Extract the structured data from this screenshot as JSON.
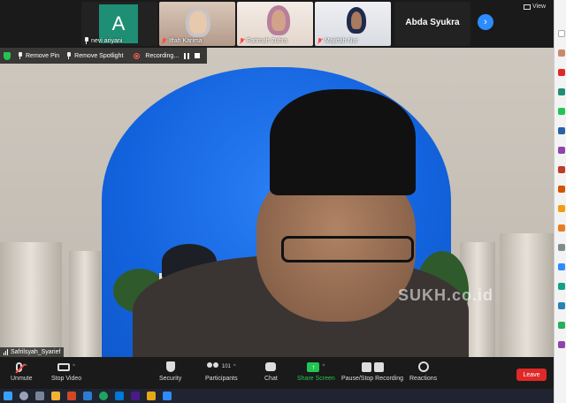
{
  "gallery": {
    "tiles": [
      {
        "name": "nevi ariyani",
        "initial": "A",
        "type": "avatar"
      },
      {
        "name": "Iffah Karima",
        "type": "video"
      },
      {
        "name": "Farimah Zuhra",
        "type": "video"
      },
      {
        "name": "Majidah Nur",
        "type": "video"
      },
      {
        "name": "Abda Syukra",
        "type": "name-only"
      }
    ],
    "next_icon": "chevron-right-icon",
    "view_label": "View"
  },
  "video_controls": {
    "remove_pin": "Remove Pin",
    "remove_spotlight": "Remove Spotlight",
    "recording": "Recording..."
  },
  "speaker": {
    "name": "Safrilsyah_Syarief",
    "watermark": "SUKH.co.id"
  },
  "toolbar": {
    "unmute": "Unmute",
    "stop_video": "Stop Video",
    "security": "Security",
    "participants": "Participants",
    "participant_count": "101",
    "chat": "Chat",
    "share_screen": "Share Screen",
    "pause_stop_recording": "Pause/Stop Recording",
    "reactions": "Reactions",
    "leave": "Leave"
  },
  "colors": {
    "accent": "#2d8cff",
    "share_green": "#23c552",
    "leave_red": "#e02828",
    "muted_red": "#ff4c4c"
  }
}
